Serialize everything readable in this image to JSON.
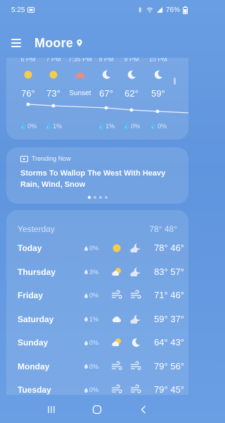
{
  "status": {
    "time": "5:25",
    "battery": "76%"
  },
  "header": {
    "city": "Moore"
  },
  "hourly": [
    {
      "time": "6 PM",
      "icon": "sun-icon",
      "temp": "76°",
      "precip": "0%"
    },
    {
      "time": "7 PM",
      "icon": "sun-icon",
      "temp": "73°",
      "precip": "1%"
    },
    {
      "time": "7:35 PM",
      "icon": "sunset-icon",
      "temp": "Sunset",
      "precip": ""
    },
    {
      "time": "8 PM",
      "icon": "moon-icon",
      "temp": "67°",
      "precip": "1%"
    },
    {
      "time": "9 PM",
      "icon": "moon-icon",
      "temp": "62°",
      "precip": "0%"
    },
    {
      "time": "10 PM",
      "icon": "moon-icon",
      "temp": "59°",
      "precip": "0%"
    }
  ],
  "news": {
    "label": "Trending Now",
    "headline": "Storms To Wallop The West With Heavy Rain, Wind, Snow"
  },
  "daily": {
    "yesterday": {
      "label": "Yesterday",
      "temps": "78° 48°"
    },
    "days": [
      {
        "name": "Today",
        "precip": "0%",
        "icon_day": "sun-icon",
        "icon_night": "partly-cloudy-night-icon",
        "temps": "78° 46°"
      },
      {
        "name": "Thursday",
        "precip": "3%",
        "icon_day": "partly-cloudy-icon",
        "icon_night": "partly-cloudy-night-icon",
        "temps": "83° 57°"
      },
      {
        "name": "Friday",
        "precip": "0%",
        "icon_day": "wind-icon",
        "icon_night": "wind-icon",
        "temps": "71° 46°"
      },
      {
        "name": "Saturday",
        "precip": "1%",
        "icon_day": "cloud-icon",
        "icon_night": "partly-cloudy-night-icon",
        "temps": "59° 37°"
      },
      {
        "name": "Sunday",
        "precip": "0%",
        "icon_day": "partly-cloudy-icon",
        "icon_night": "moon-icon",
        "temps": "64° 43°"
      },
      {
        "name": "Monday",
        "precip": "0%",
        "icon_day": "wind-icon",
        "icon_night": "wind-icon",
        "temps": "79° 56°"
      },
      {
        "name": "Tuesday",
        "precip": "0%",
        "icon_day": "wind-icon",
        "icon_night": "wind-icon",
        "temps": "79° 45°"
      }
    ]
  }
}
